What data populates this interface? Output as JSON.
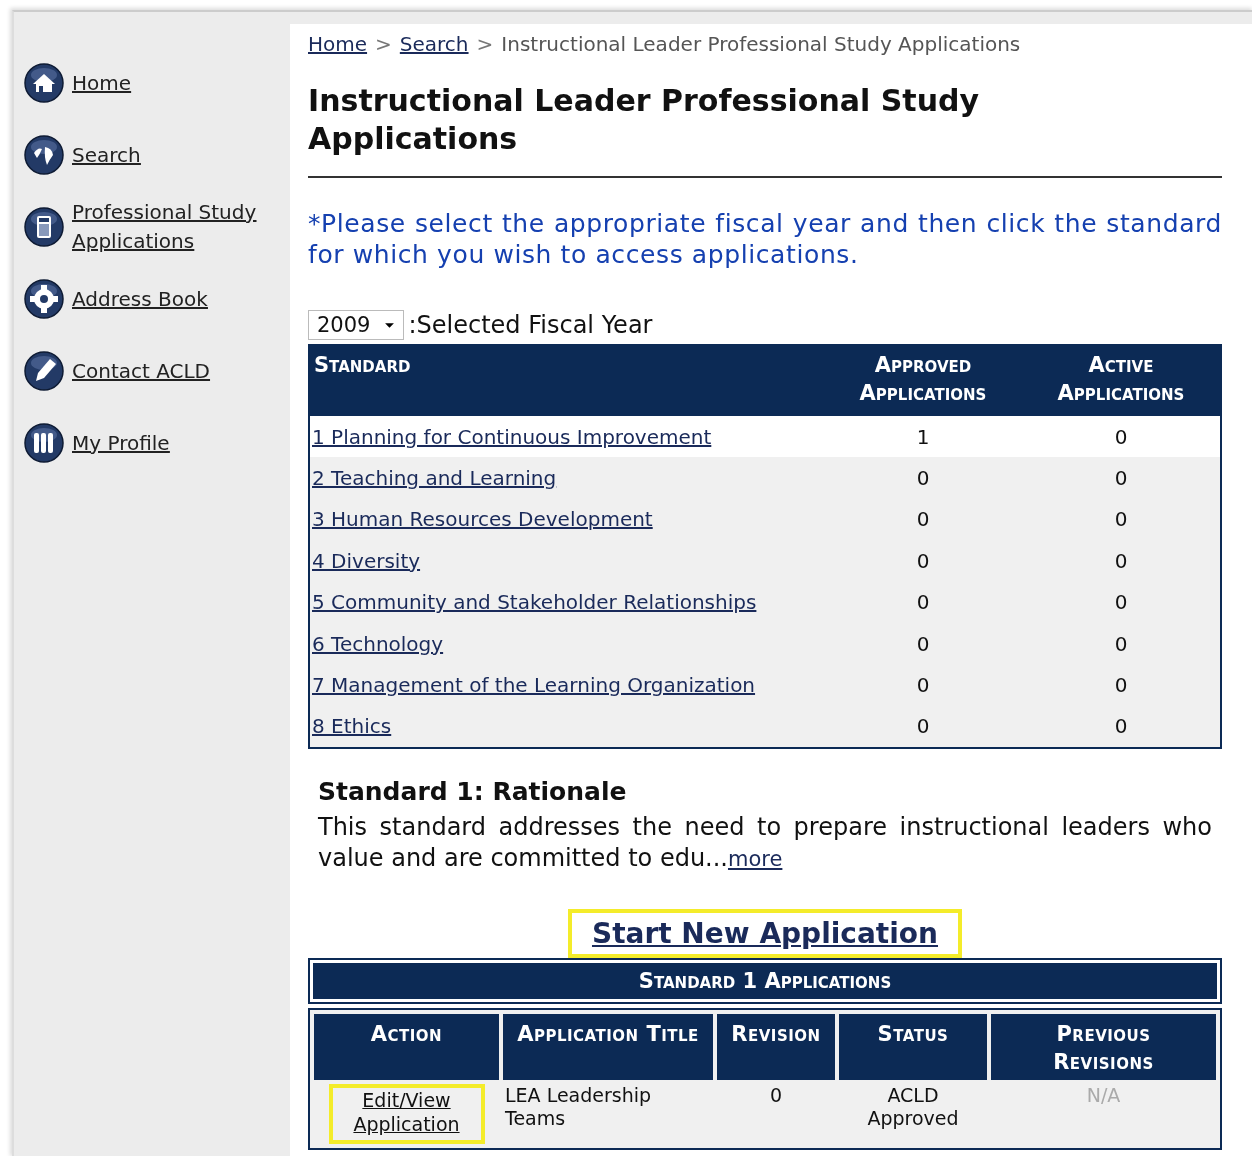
{
  "sidebar": {
    "items": [
      {
        "label": "Home"
      },
      {
        "label": "Search"
      },
      {
        "label": "Professional Study Applications"
      },
      {
        "label": "Address Book"
      },
      {
        "label": "Contact ACLD"
      },
      {
        "label": "My Profile"
      }
    ]
  },
  "breadcrumb": {
    "links": [
      "Home",
      "Search"
    ],
    "separators": [
      ">",
      ">"
    ],
    "current": "Instructional Leader Professional Study Applications"
  },
  "title": "Instructional Leader Professional Study Applications",
  "instruction": "*Please select the appropriate fiscal year and then click the standard for which you wish to access applications.",
  "fiscal_year": {
    "value": "2009",
    "label": ":Selected Fiscal Year"
  },
  "standards_table": {
    "columns": [
      "Standard",
      "Approved Applications",
      "Active Applications"
    ],
    "rows": [
      {
        "standard": "1 Planning for Continuous Improvement",
        "approved": "1",
        "active": "0",
        "selected": true
      },
      {
        "standard": "2 Teaching and Learning",
        "approved": "0",
        "active": "0",
        "selected": false
      },
      {
        "standard": "3 Human Resources Development",
        "approved": "0",
        "active": "0",
        "selected": false
      },
      {
        "standard": "4 Diversity",
        "approved": "0",
        "active": "0",
        "selected": false
      },
      {
        "standard": "5 Community and Stakeholder Relationships",
        "approved": "0",
        "active": "0",
        "selected": false
      },
      {
        "standard": "6 Technology",
        "approved": "0",
        "active": "0",
        "selected": false
      },
      {
        "standard": "7 Management of the Learning Organization",
        "approved": "0",
        "active": "0",
        "selected": false
      },
      {
        "standard": "8 Ethics",
        "approved": "0",
        "active": "0",
        "selected": false
      }
    ]
  },
  "rationale": {
    "heading": "Standard 1: Rationale",
    "text": "This standard addresses the need to prepare instructional leaders who value and are committed to edu...",
    "more_link": "more"
  },
  "start_button": {
    "label": "Start New Application",
    "highlighted": true
  },
  "applications_table": {
    "title": "Standard 1 Applications",
    "columns": [
      "Action",
      "Application Title",
      "Revision",
      "Status",
      "Previous Revisions"
    ],
    "rows": [
      {
        "action": "Edit/View Application",
        "action_highlighted": true,
        "title": "LEA Leadership Teams",
        "revision": "0",
        "status": "ACLD Approved",
        "previous": "N/A",
        "previous_disabled": true
      }
    ]
  }
}
